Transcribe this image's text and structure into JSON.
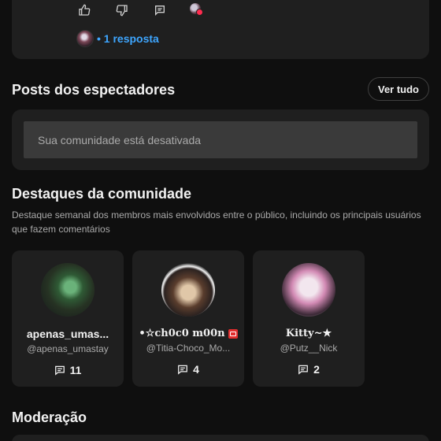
{
  "comment": {
    "reply_text": "• 1 resposta",
    "icons": [
      "thumbs-up-icon",
      "thumbs-down-icon",
      "reply-icon",
      "creator-heart-icon"
    ]
  },
  "posts": {
    "title": "Posts dos espectadores",
    "see_all": "Ver tudo",
    "input_placeholder": "Sua comunidade está desativada"
  },
  "highlights": {
    "title": "Destaques da comunidade",
    "description": "Destaque semanal dos membros mais envolvidos entre o público, incluindo os principais usuários que fazem comentários",
    "cards": [
      {
        "name": "apenas_umas...",
        "handle": "@apenas_umastay",
        "count": "11"
      },
      {
        "name": "•☆ch0c0 m00n",
        "handle": "@Titia-Choco_Mo...",
        "count": "4"
      },
      {
        "name": "Kitty~★",
        "handle": "@Putz__Nick",
        "count": "2"
      }
    ]
  },
  "moderation": {
    "title": "Moderação"
  },
  "colors": {
    "background": "#0f0f0f",
    "card": "#1f1f1f",
    "link": "#3ea6ff",
    "muted": "#aaaaaa"
  }
}
